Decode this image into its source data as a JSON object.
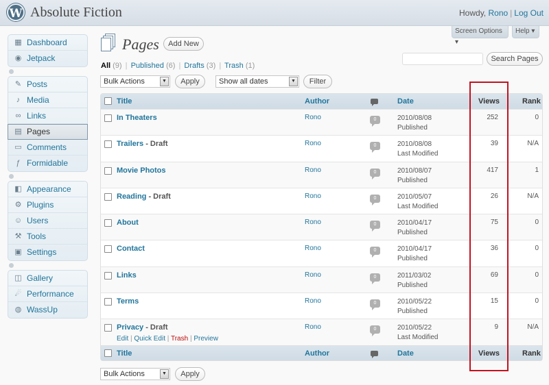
{
  "site": {
    "logo": "W",
    "title": "Absolute Fiction"
  },
  "user": {
    "greeting": "Howdy,",
    "name": "Rono",
    "logout": "Log Out"
  },
  "tabs": {
    "screen_options": "Screen Options ▾",
    "help": "Help ▾"
  },
  "menu": {
    "groups": [
      [
        {
          "label": "Dashboard",
          "icon": "dashboard-icon"
        },
        {
          "label": "Jetpack",
          "icon": "jetpack-icon"
        }
      ],
      [
        {
          "label": "Posts",
          "icon": "posts-icon"
        },
        {
          "label": "Media",
          "icon": "media-icon"
        },
        {
          "label": "Links",
          "icon": "links-icon"
        },
        {
          "label": "Pages",
          "icon": "pages-icon",
          "current": true
        },
        {
          "label": "Comments",
          "icon": "comments-icon"
        },
        {
          "label": "Formidable",
          "icon": "formidable-icon"
        }
      ],
      [
        {
          "label": "Appearance",
          "icon": "appearance-icon"
        },
        {
          "label": "Plugins",
          "icon": "plugins-icon"
        },
        {
          "label": "Users",
          "icon": "users-icon"
        },
        {
          "label": "Tools",
          "icon": "tools-icon"
        },
        {
          "label": "Settings",
          "icon": "settings-icon"
        }
      ],
      [
        {
          "label": "Gallery",
          "icon": "gallery-icon"
        },
        {
          "label": "Performance",
          "icon": "performance-icon"
        },
        {
          "label": "WassUp",
          "icon": "wassup-icon"
        }
      ]
    ]
  },
  "page": {
    "title": "Pages",
    "add_new": "Add New"
  },
  "filters": {
    "all": "All",
    "all_count": "(9)",
    "published": "Published",
    "published_count": "(6)",
    "drafts": "Drafts",
    "drafts_count": "(3)",
    "trash": "Trash",
    "trash_count": "(1)",
    "sep": "|"
  },
  "search": {
    "button": "Search Pages",
    "value": ""
  },
  "bulk": {
    "label": "Bulk Actions",
    "apply": "Apply",
    "dates": "Show all dates",
    "filter": "Filter"
  },
  "columns": {
    "title": "Title",
    "author": "Author",
    "date": "Date",
    "views": "Views",
    "rank": "Rank"
  },
  "rows": [
    {
      "title": "In Theaters",
      "status_suffix": "",
      "author": "Rono",
      "comments": "0",
      "date": "2010/08/08",
      "state": "Published",
      "views": "252",
      "rank": "0"
    },
    {
      "title": "Trailers",
      "status_suffix": " - Draft",
      "author": "Rono",
      "comments": "0",
      "date": "2010/08/08",
      "state": "Last Modified",
      "views": "39",
      "rank": "N/A"
    },
    {
      "title": "Movie Photos",
      "status_suffix": "",
      "author": "Rono",
      "comments": "0",
      "date": "2010/08/07",
      "state": "Published",
      "views": "417",
      "rank": "1"
    },
    {
      "title": "Reading",
      "status_suffix": " - Draft",
      "author": "Rono",
      "comments": "0",
      "date": "2010/05/07",
      "state": "Last Modified",
      "views": "26",
      "rank": "N/A"
    },
    {
      "title": "About",
      "status_suffix": "",
      "author": "Rono",
      "comments": "0",
      "date": "2010/04/17",
      "state": "Published",
      "views": "75",
      "rank": "0"
    },
    {
      "title": "Contact",
      "status_suffix": "",
      "author": "Rono",
      "comments": "0",
      "date": "2010/04/17",
      "state": "Published",
      "views": "36",
      "rank": "0"
    },
    {
      "title": "Links",
      "status_suffix": "",
      "author": "Rono",
      "comments": "0",
      "date": "2011/03/02",
      "state": "Published",
      "views": "69",
      "rank": "0"
    },
    {
      "title": "Terms",
      "status_suffix": "",
      "author": "Rono",
      "comments": "0",
      "date": "2010/05/22",
      "state": "Published",
      "views": "15",
      "rank": "0"
    },
    {
      "title": "Privacy",
      "status_suffix": " - Draft",
      "author": "Rono",
      "comments": "0",
      "date": "2010/05/22",
      "state": "Last Modified",
      "views": "9",
      "rank": "N/A",
      "actions": {
        "edit": "Edit",
        "quick_edit": "Quick Edit",
        "trash": "Trash",
        "preview": "Preview"
      }
    }
  ],
  "colors": {
    "link": "#21759b",
    "highlight": "#c1121f",
    "trash": "#bc0b0b"
  }
}
